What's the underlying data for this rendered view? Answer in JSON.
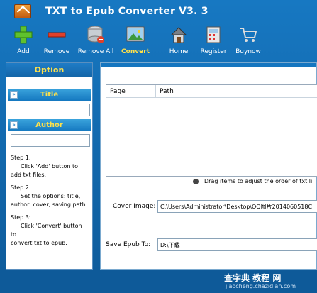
{
  "app": {
    "title": "TXT to Epub Converter V3. 3"
  },
  "toolbar": {
    "add": "Add",
    "remove": "Remove",
    "remove_all": "Remove All",
    "convert": "Convert",
    "home": "Home",
    "register": "Register",
    "buynow": "Buynow"
  },
  "left": {
    "option_title": "Option",
    "title_section": "Title",
    "title_value": "",
    "author_section": "Author",
    "author_value": "",
    "step1_head": "Step 1:",
    "step1_body": "Click 'Add' button to",
    "step1_tail": "add txt files.",
    "step2_head": "Step 2:",
    "step2_body": "Set the options: title,",
    "step2_tail": "author, cover, saving path.",
    "step3_head": "Step 3:",
    "step3_body": "Click 'Convert' button to",
    "step3_tail": "convert txt to epub."
  },
  "main": {
    "col_page": "Page",
    "col_path": "Path",
    "hint": "Drag items to  adjust the order of txt li",
    "cover_label": "Cover Image:",
    "cover_value": "C:\\Users\\Administrator\\Desktop\\QQ图片2014060518C",
    "save_label": "Save Epub To:",
    "save_value": "D:\\下载"
  },
  "watermark": {
    "main": "查字典 教程 网",
    "sub": "jiaocheng.chazidian.com"
  },
  "colors": {
    "accent_yellow": "#ffe14a",
    "app_blue": "#1778c2"
  }
}
